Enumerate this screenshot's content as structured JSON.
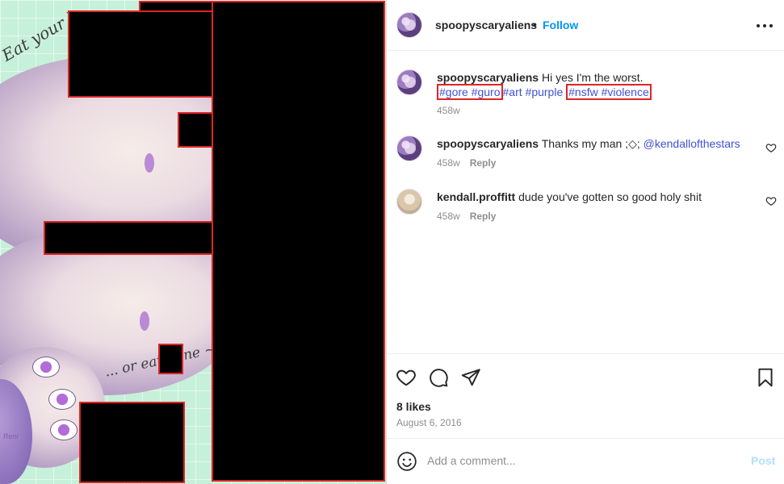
{
  "media": {
    "artwork_text_top": "Eat your h",
    "artwork_text_bottom": "... or eat mine ~",
    "artist_signature": "Reni"
  },
  "header": {
    "username": "spoopyscaryaliens",
    "separator": "•",
    "follow_label": "Follow",
    "more_icon": "more-horizontal-icon"
  },
  "caption": {
    "username": "spoopyscaryaliens",
    "text": "Hi yes I'm the worst.",
    "hashtags": [
      "#gore",
      "#guro",
      "#art",
      "#purple",
      "#nsfw",
      "#violence"
    ],
    "highlighted_groups": [
      [
        "#gore",
        "#guro"
      ],
      [
        "#nsfw",
        "#violence"
      ]
    ],
    "time": "458w"
  },
  "comments": [
    {
      "username": "spoopyscaryaliens",
      "text": "Thanks my man ;◇;",
      "mention": "@kendallofthestars",
      "time": "458w",
      "reply_label": "Reply",
      "like_icon": "heart-outline-icon"
    },
    {
      "username": "kendall.proffitt",
      "text": "dude you've gotten so good holy shit",
      "mention": "",
      "time": "458w",
      "reply_label": "Reply",
      "like_icon": "heart-outline-icon"
    }
  ],
  "actions": {
    "icons": [
      "heart-outline-icon",
      "comment-icon",
      "share-icon",
      "bookmark-icon"
    ],
    "likes": "8 likes",
    "date": "August 6, 2016"
  },
  "add_comment": {
    "emoji_icon": "emoji-icon",
    "placeholder": "Add a comment...",
    "post_label": "Post"
  },
  "colors": {
    "link_blue": "#0095f6",
    "hashtag_blue": "#3f51d6",
    "redaction_border": "#e02424",
    "muted_text": "#8e8e8e"
  }
}
